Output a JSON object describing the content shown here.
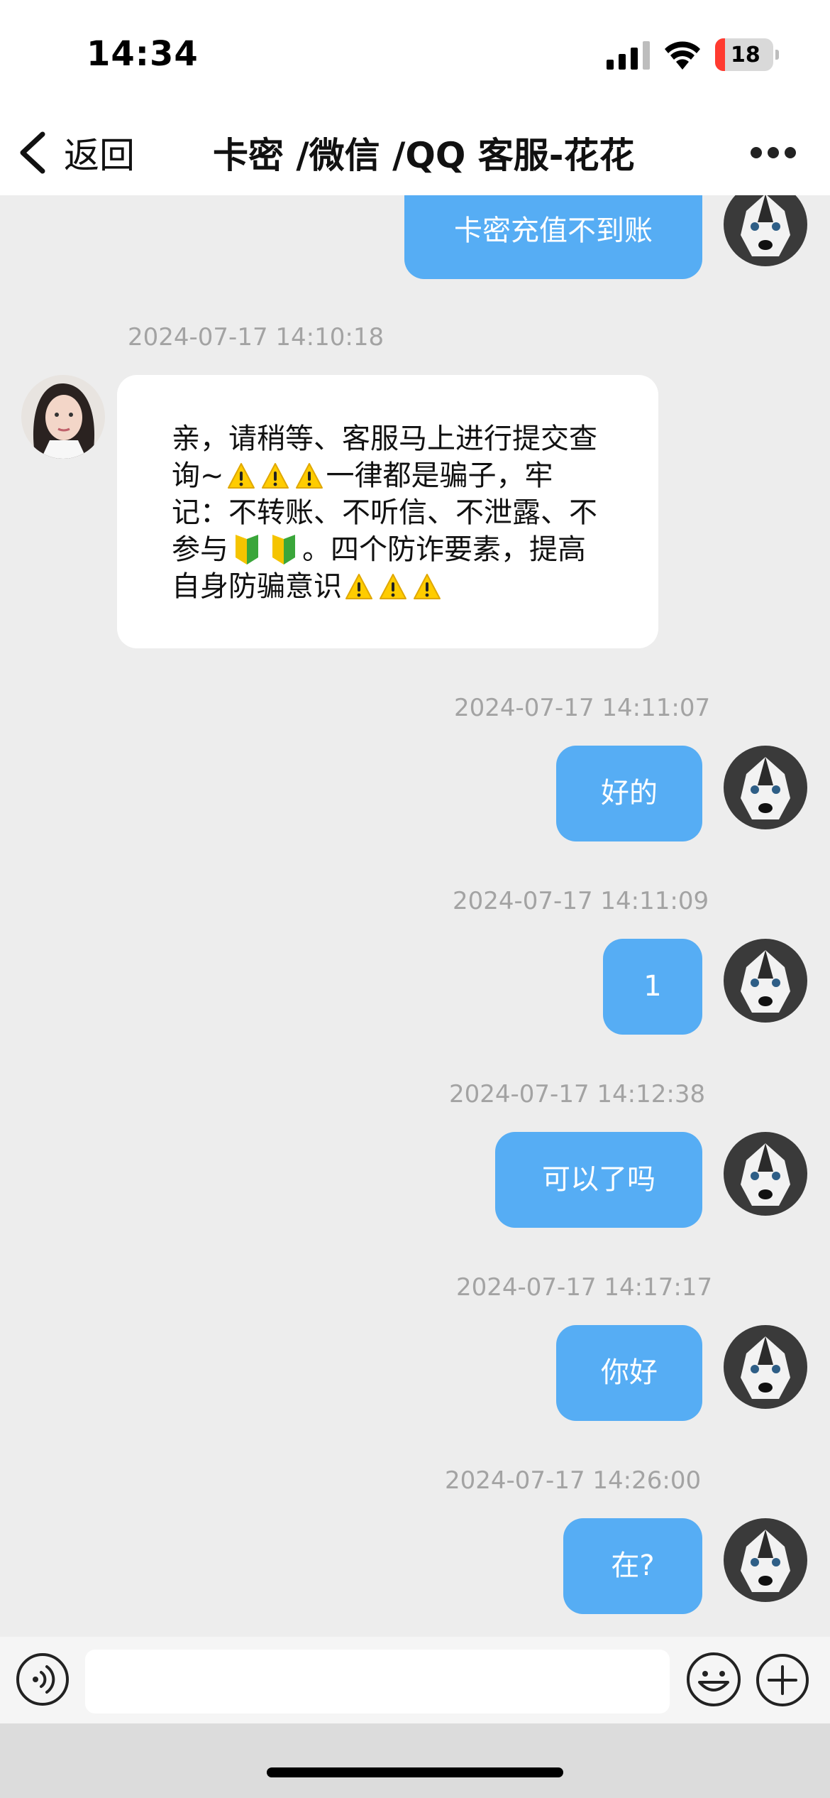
{
  "status_bar": {
    "time": "14:34",
    "battery": "18"
  },
  "nav": {
    "back_label": "返回",
    "title": "卡密 /微信 /QQ 客服-花花"
  },
  "messages": [
    {
      "text": "卡密充值不到账"
    },
    {
      "timestamp": "2024-07-17 14:10:18",
      "line1": "亲，请稍等、客服马上进行提交查",
      "line2": "询~",
      "line2_after": "一律都是骗子，牢",
      "line3": "记：不转账、不听信、不泄露、不",
      "line4": "参与",
      "line4_after": "。四个防诈要素，提高",
      "line5": "自身防骗意识"
    },
    {
      "timestamp": "2024-07-17 14:11:07",
      "text": "好的"
    },
    {
      "timestamp": "2024-07-17 14:11:09",
      "text": "1"
    },
    {
      "timestamp": "2024-07-17 14:12:38",
      "text": "可以了吗"
    },
    {
      "timestamp": "2024-07-17 14:17:17",
      "text": "你好"
    },
    {
      "timestamp": "2024-07-17 14:26:00",
      "text": "在?"
    }
  ],
  "input": {
    "placeholder": ""
  },
  "colors": {
    "outgoing_bubble": "#56adf4",
    "incoming_bubble": "#ffffff",
    "background": "#ededed"
  }
}
